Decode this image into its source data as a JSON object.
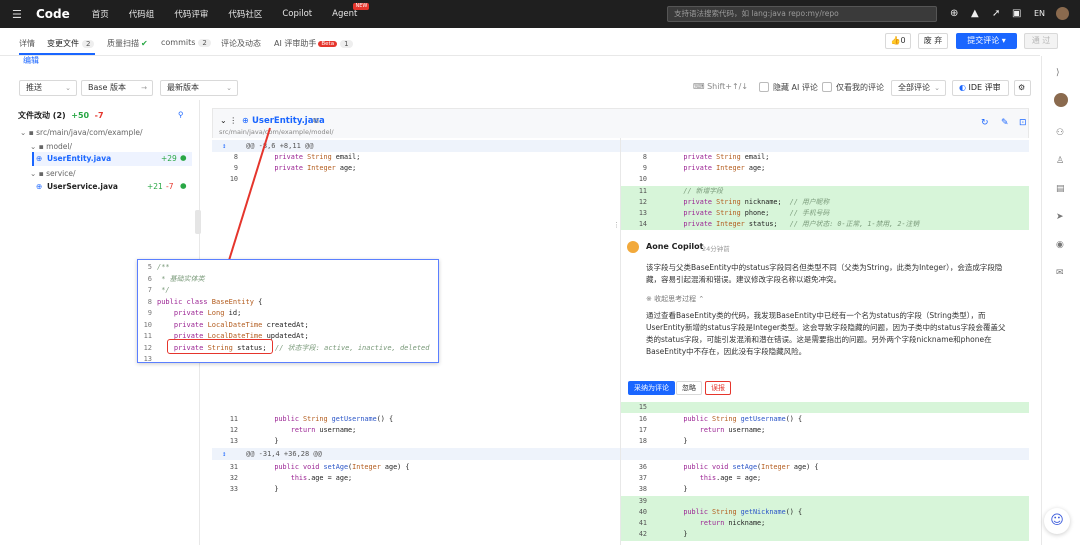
{
  "topnav": {
    "brand": "Code",
    "items": [
      "首页",
      "代码组",
      "代码评审",
      "代码社区",
      "Copilot",
      "Agent"
    ],
    "agent_badge": "NEW",
    "search_placeholder": "支持语法搜索代码，如 lang:java repo:my/repo",
    "language": "EN"
  },
  "tabs": {
    "details": "详情",
    "changed_files": "变更文件",
    "changed_files_count": "2",
    "quality_scan": "质量扫描",
    "commits": "commits",
    "commits_count": "2",
    "comments": "评论及动态",
    "ai_assistant": "AI 评审助手",
    "ai_badge": "Beta",
    "ai_count": "1"
  },
  "actions": {
    "like_count": "0",
    "ignore": "废 弃",
    "submit": "提交评论",
    "approve": "通 过"
  },
  "edit_link": "编辑",
  "toolbar": {
    "push": "推送",
    "base_version": "Base 版本",
    "latest_version": "最新版本",
    "shortcut": "Shift+↑/↓",
    "hide_ai": "隐藏 AI 评论",
    "only_mine": "仅看我的评论",
    "all_comments": "全部评论",
    "ide_review": "IDE 评审"
  },
  "filetree": {
    "title": "文件改动 (2)",
    "added": "+50",
    "removed": "-7",
    "path_root": "src/main/java/com/example/",
    "folder_model": "model/",
    "file_user_entity": "UserEntity.java",
    "file_user_entity_add": "+29",
    "folder_service": "service/",
    "file_user_service": "UserService.java",
    "file_user_service_add": "+21",
    "file_user_service_del": "-7"
  },
  "diff": {
    "file_name": "UserEntity.java",
    "file_path": "src/main/java/com/example/model/",
    "hunk1": "@@ -8,6 +8,11 @@",
    "hunk2": "@@ -31,4 +36,28 @@",
    "left_lines": [
      {
        "n": "8",
        "t": "    private String email;"
      },
      {
        "n": "9",
        "t": "    private Integer age;"
      },
      {
        "n": "10",
        "t": ""
      }
    ],
    "right_lines": [
      {
        "n": "8",
        "t": "    private String email;"
      },
      {
        "n": "9",
        "t": "    private Integer age;"
      },
      {
        "n": "10",
        "t": ""
      },
      {
        "n": "11",
        "t": "    // 新增字段"
      },
      {
        "n": "12",
        "t": "    private String nickname;  // 用户昵称"
      },
      {
        "n": "13",
        "t": "    private String phone;     // 手机号码"
      },
      {
        "n": "14",
        "t": "    private Integer status;   // 用户状态: 0-正常, 1-禁用, 2-注销"
      }
    ],
    "mid_left": [
      {
        "n": "11",
        "t": "    public String getUsername() {"
      },
      {
        "n": "12",
        "t": "        return username;"
      },
      {
        "n": "13",
        "t": "    }"
      }
    ],
    "mid_right": [
      {
        "n": "15",
        "t": ""
      },
      {
        "n": "16",
        "t": "    public String getUsername() {"
      },
      {
        "n": "17",
        "t": "        return username;"
      },
      {
        "n": "18",
        "t": "    }"
      }
    ],
    "bot_left": [
      {
        "n": "31",
        "t": "    public void setAge(Integer age) {"
      },
      {
        "n": "32",
        "t": "        this.age = age;"
      },
      {
        "n": "33",
        "t": "    }"
      }
    ],
    "bot_right": [
      {
        "n": "36",
        "t": "    public void setAge(Integer age) {"
      },
      {
        "n": "37",
        "t": "        this.age = age;"
      },
      {
        "n": "38",
        "t": "    }"
      },
      {
        "n": "39",
        "t": ""
      },
      {
        "n": "40",
        "t": "    public String getNickname() {"
      },
      {
        "n": "41",
        "t": "        return nickname;"
      },
      {
        "n": "42",
        "t": "    }"
      }
    ]
  },
  "comment": {
    "author": "Aone Copilot",
    "time": "24分钟前",
    "text": "该字段与父类BaseEntity中的status字段同名但类型不同（父类为String，此类为Integer），会造成字段隐藏，容易引起混淆和错误。建议修改字段名称以避免冲突。",
    "think_toggle": "※ 收起思考过程 ⌃",
    "think_text": "通过查看BaseEntity类的代码，我发现BaseEntity中已经有一个名为status的字段（String类型），而UserEntity新增的status字段是Integer类型。这会导致字段隐藏的问题，因为子类中的status字段会覆盖父类的status字段，可能引发混淆和潜在错误。这是需要指出的问题。另外两个字段nickname和phone在BaseEntity中不存在，因此没有字段隐藏风险。",
    "adopt": "采纳为评论",
    "ignore": "忽略",
    "misreport": "误报"
  },
  "callout": [
    {
      "n": "5",
      "t": "/**"
    },
    {
      "n": "6",
      "t": " * 基础实体类"
    },
    {
      "n": "7",
      "t": " */"
    },
    {
      "n": "8",
      "t": "public class BaseEntity {"
    },
    {
      "n": "9",
      "t": "    private Long id;"
    },
    {
      "n": "10",
      "t": "    private LocalDateTime createdAt;"
    },
    {
      "n": "11",
      "t": "    private LocalDateTime updatedAt;"
    },
    {
      "n": "12",
      "t": "    private String status;  // 状态字段: active, inactive, deleted"
    },
    {
      "n": "13",
      "t": ""
    }
  ]
}
